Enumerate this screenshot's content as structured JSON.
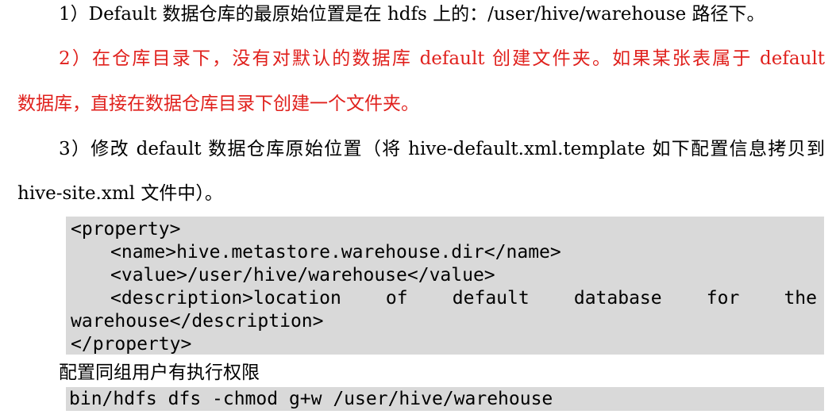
{
  "paragraphs": {
    "p1": "1）Default 数据仓库的最原始位置是在 hdfs 上的：/user/hive/warehouse 路径下。",
    "p2_line1": "2）在仓库目录下，没有对默认的数据库 default 创建文件夹。如果某张表属于 default",
    "p2_line2": "数据库，直接在数据仓库目录下创建一个文件夹。",
    "p3_line1": "3）修改 default 数据仓库原始位置（将 hive-default.xml.template 如下配置信息拷贝到",
    "p3_line2": "hive-site.xml 文件中）。"
  },
  "code": {
    "line1": "<property>",
    "line2": "<name>hive.metastore.warehouse.dir</name>",
    "line3": "<value>/user/hive/warehouse</value>",
    "line4": "<description>location of default database for the",
    "line5": "warehouse</description>",
    "line6": "</property>"
  },
  "caption": "配置同组用户有执行权限",
  "command": "bin/hdfs dfs -chmod g+w /user/hive/warehouse",
  "colors": {
    "highlight_text": "#e0211d",
    "code_background": "#d9d9d9"
  }
}
